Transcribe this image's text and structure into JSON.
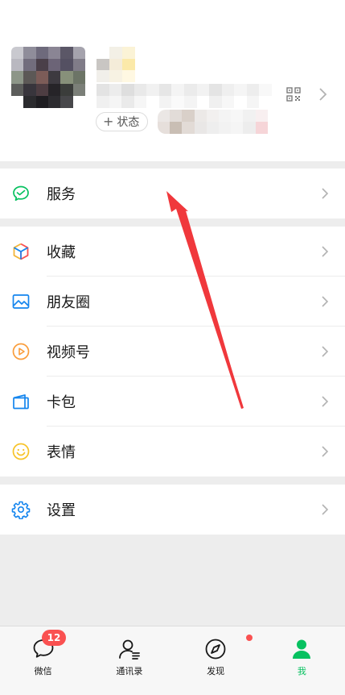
{
  "profile": {
    "status_label": "状态",
    "status_plus": "+",
    "icons": [
      "qr-code-icon",
      "chevron-right-icon"
    ]
  },
  "menu": {
    "service": {
      "label": "服务",
      "icon": "wechat-pay-icon",
      "color": "#07c160"
    },
    "favorites": {
      "label": "收藏",
      "icon": "favorites-cube-icon",
      "color": "#f2b53a"
    },
    "moments": {
      "label": "朋友圈",
      "icon": "photo-album-icon",
      "color": "#1485ee"
    },
    "channels": {
      "label": "视频号",
      "icon": "play-circle-icon",
      "color": "#fa9d3b"
    },
    "card_wallet": {
      "label": "卡包",
      "icon": "wallet-icon",
      "color": "#1485ee"
    },
    "stickers": {
      "label": "表情",
      "icon": "smiley-icon",
      "color": "#f7c328"
    },
    "settings": {
      "label": "设置",
      "icon": "gear-icon",
      "color": "#1485ee"
    }
  },
  "tabbar": {
    "chats": {
      "label": "微信",
      "badge": "12",
      "icon": "chat-bubble-icon"
    },
    "contacts": {
      "label": "通讯录",
      "icon": "contacts-icon"
    },
    "discover": {
      "label": "发现",
      "icon": "compass-icon",
      "has_dot": true
    },
    "me": {
      "label": "我",
      "icon": "person-icon",
      "active": true
    }
  },
  "colors": {
    "accent": "#07c160",
    "badge": "#fa5151",
    "annotation_arrow": "#f0383c"
  }
}
